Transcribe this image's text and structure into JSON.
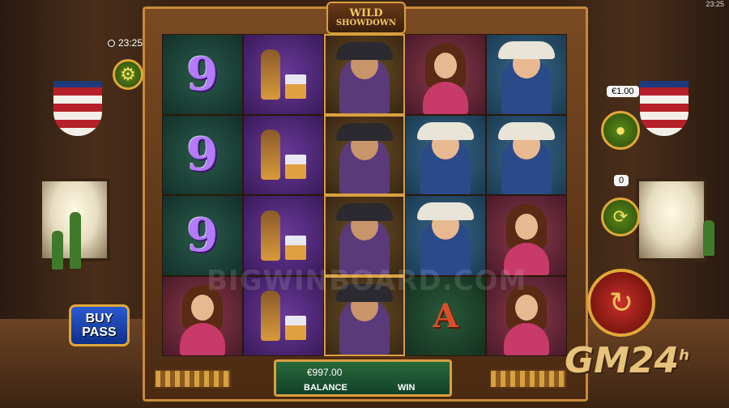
{
  "header": {
    "logo_line1": "WILD",
    "logo_line2": "SHOWDOWN",
    "top_time": "23:25"
  },
  "clock": {
    "time": "23:25"
  },
  "controls": {
    "settings_icon": "gear-icon",
    "bet_value": "€1.00",
    "bet_icon": "coins-icon",
    "autoplay_count": "0",
    "autoplay_icon": "autoplay-icon",
    "spin_icon": "spin-icon",
    "buy_pass_line1": "BUY",
    "buy_pass_line2": "PASS"
  },
  "reels": {
    "rows": [
      [
        "9",
        "whiskey",
        "bandit",
        "saloon-girl",
        "sheriff"
      ],
      [
        "9",
        "whiskey",
        "bandit",
        "sheriff",
        "sheriff"
      ],
      [
        "9",
        "whiskey",
        "bandit",
        "sheriff",
        "saloon-girl"
      ],
      [
        "saloon-girl",
        "whiskey",
        "bandit",
        "A",
        "saloon-girl"
      ]
    ]
  },
  "bottom_bar": {
    "balance_value": "€997.00",
    "balance_label": "BALANCE",
    "win_label": "WIN"
  },
  "watermarks": {
    "gm24": "GM24",
    "gm24_sup": "h",
    "bigwin": "BIGWINBOARD.COM"
  },
  "colors": {
    "frame_gold": "#d8a040",
    "spin_red": "#c8302a",
    "button_green": "#5a8a1a",
    "buy_pass_blue": "#2a5ad0"
  }
}
